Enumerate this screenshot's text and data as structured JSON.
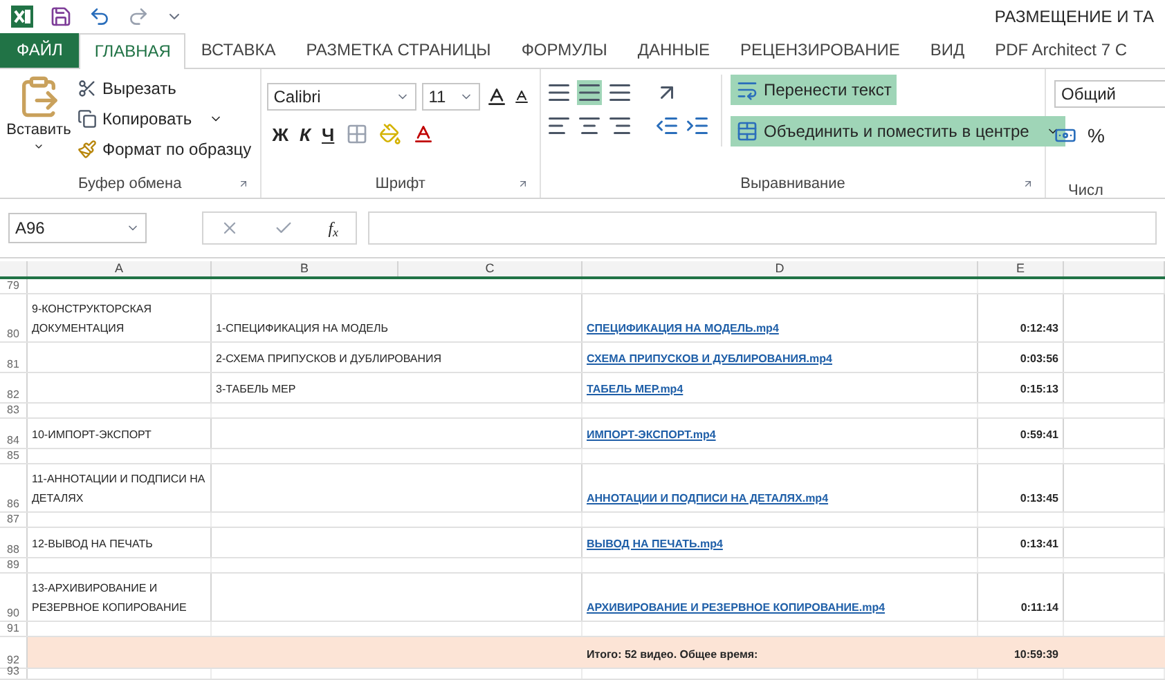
{
  "window": {
    "title": "РАЗМЕЩЕНИЕ И ТА"
  },
  "tabs": [
    {
      "label": "ФАЙЛ",
      "kind": "file",
      "selected": false
    },
    {
      "label": "ГЛАВНАЯ",
      "kind": "tab",
      "selected": true
    },
    {
      "label": "ВСТАВКА",
      "kind": "tab",
      "selected": false
    },
    {
      "label": "РАЗМЕТКА СТРАНИЦЫ",
      "kind": "tab",
      "selected": false
    },
    {
      "label": "ФОРМУЛЫ",
      "kind": "tab",
      "selected": false
    },
    {
      "label": "ДАННЫЕ",
      "kind": "tab",
      "selected": false
    },
    {
      "label": "РЕЦЕНЗИРОВАНИЕ",
      "kind": "tab",
      "selected": false
    },
    {
      "label": "ВИД",
      "kind": "tab",
      "selected": false
    },
    {
      "label": "PDF Architect 7 C",
      "kind": "tab",
      "selected": false
    }
  ],
  "ribbon": {
    "clipboard": {
      "paste": "Вставить",
      "cut": "Вырезать",
      "copy": "Копировать",
      "format_painter": "Формат по образцу",
      "label": "Буфер обмена"
    },
    "font": {
      "family": "Calibri",
      "size": "11",
      "bold": "Ж",
      "italic": "К",
      "underline": "Ч",
      "label": "Шрифт"
    },
    "alignment": {
      "center_active": true,
      "wrap_text": {
        "label": "Перенести текст",
        "active": true
      },
      "merge": {
        "label": "Объединить и поместить в центре",
        "active": true
      },
      "label": "Выравнивание"
    },
    "number": {
      "format": "Общий",
      "percent": "%",
      "label": "Числ"
    }
  },
  "formula_bar": {
    "name_box": "A96",
    "fx": "f$_{x}$"
  },
  "columns": [
    "A",
    "B",
    "C",
    "D",
    "E"
  ],
  "rows": [
    {
      "number": "79",
      "kind": "spacer"
    },
    {
      "number": "80",
      "kind": "tall",
      "a": "9-КОНСТРУКТОРСКАЯ ДОКУМЕНТАЦИЯ",
      "b": "1-СПЕЦИФИКАЦИЯ НА МОДЕЛЬ",
      "d": "СПЕЦИФИКАЦИЯ НА МОДЕЛЬ.mp4",
      "e": "0:12:43"
    },
    {
      "number": "81",
      "kind": "normal",
      "b": "2-СХЕМА ПРИПУСКОВ И ДУБЛИРОВАНИЯ",
      "d": "СХЕМА ПРИПУСКОВ И ДУБЛИРОВАНИЯ.mp4",
      "e": "0:03:56"
    },
    {
      "number": "82",
      "kind": "normal",
      "b": "3-ТАБЕЛЬ МЕР",
      "d": "ТАБЕЛЬ МЕР.mp4",
      "e": "0:15:13"
    },
    {
      "number": "83",
      "kind": "spacer"
    },
    {
      "number": "84",
      "kind": "normal",
      "a": "10-ИМПОРТ-ЭКСПОРТ",
      "d": "ИМПОРТ-ЭКСПОРТ.mp4",
      "e": "0:59:41"
    },
    {
      "number": "85",
      "kind": "spacer"
    },
    {
      "number": "86",
      "kind": "tall",
      "a": "11-АННОТАЦИИ И ПОДПИСИ НА ДЕТАЛЯХ",
      "d": "АННОТАЦИИ И ПОДПИСИ НА ДЕТАЛЯХ.mp4",
      "e": "0:13:45"
    },
    {
      "number": "87",
      "kind": "spacer"
    },
    {
      "number": "88",
      "kind": "normal",
      "a": "12-ВЫВОД НА ПЕЧАТЬ",
      "d": "ВЫВОД НА ПЕЧАТЬ.mp4",
      "e": "0:13:41"
    },
    {
      "number": "89",
      "kind": "spacer"
    },
    {
      "number": "90",
      "kind": "tall",
      "a": "13-АРХИВИРОВАНИЕ И РЕЗЕРВНОЕ КОПИРОВАНИЕ",
      "d": "АРХИВИРОВАНИЕ И РЕЗЕРВНОЕ КОПИРОВАНИЕ.mp4",
      "e": "0:11:14"
    },
    {
      "number": "91",
      "kind": "spacer"
    },
    {
      "number": "92",
      "kind": "total",
      "d": "Итого: 52 видео. Общее время:",
      "e": "10:59:39"
    },
    {
      "number": "93",
      "kind": "end"
    }
  ]
}
